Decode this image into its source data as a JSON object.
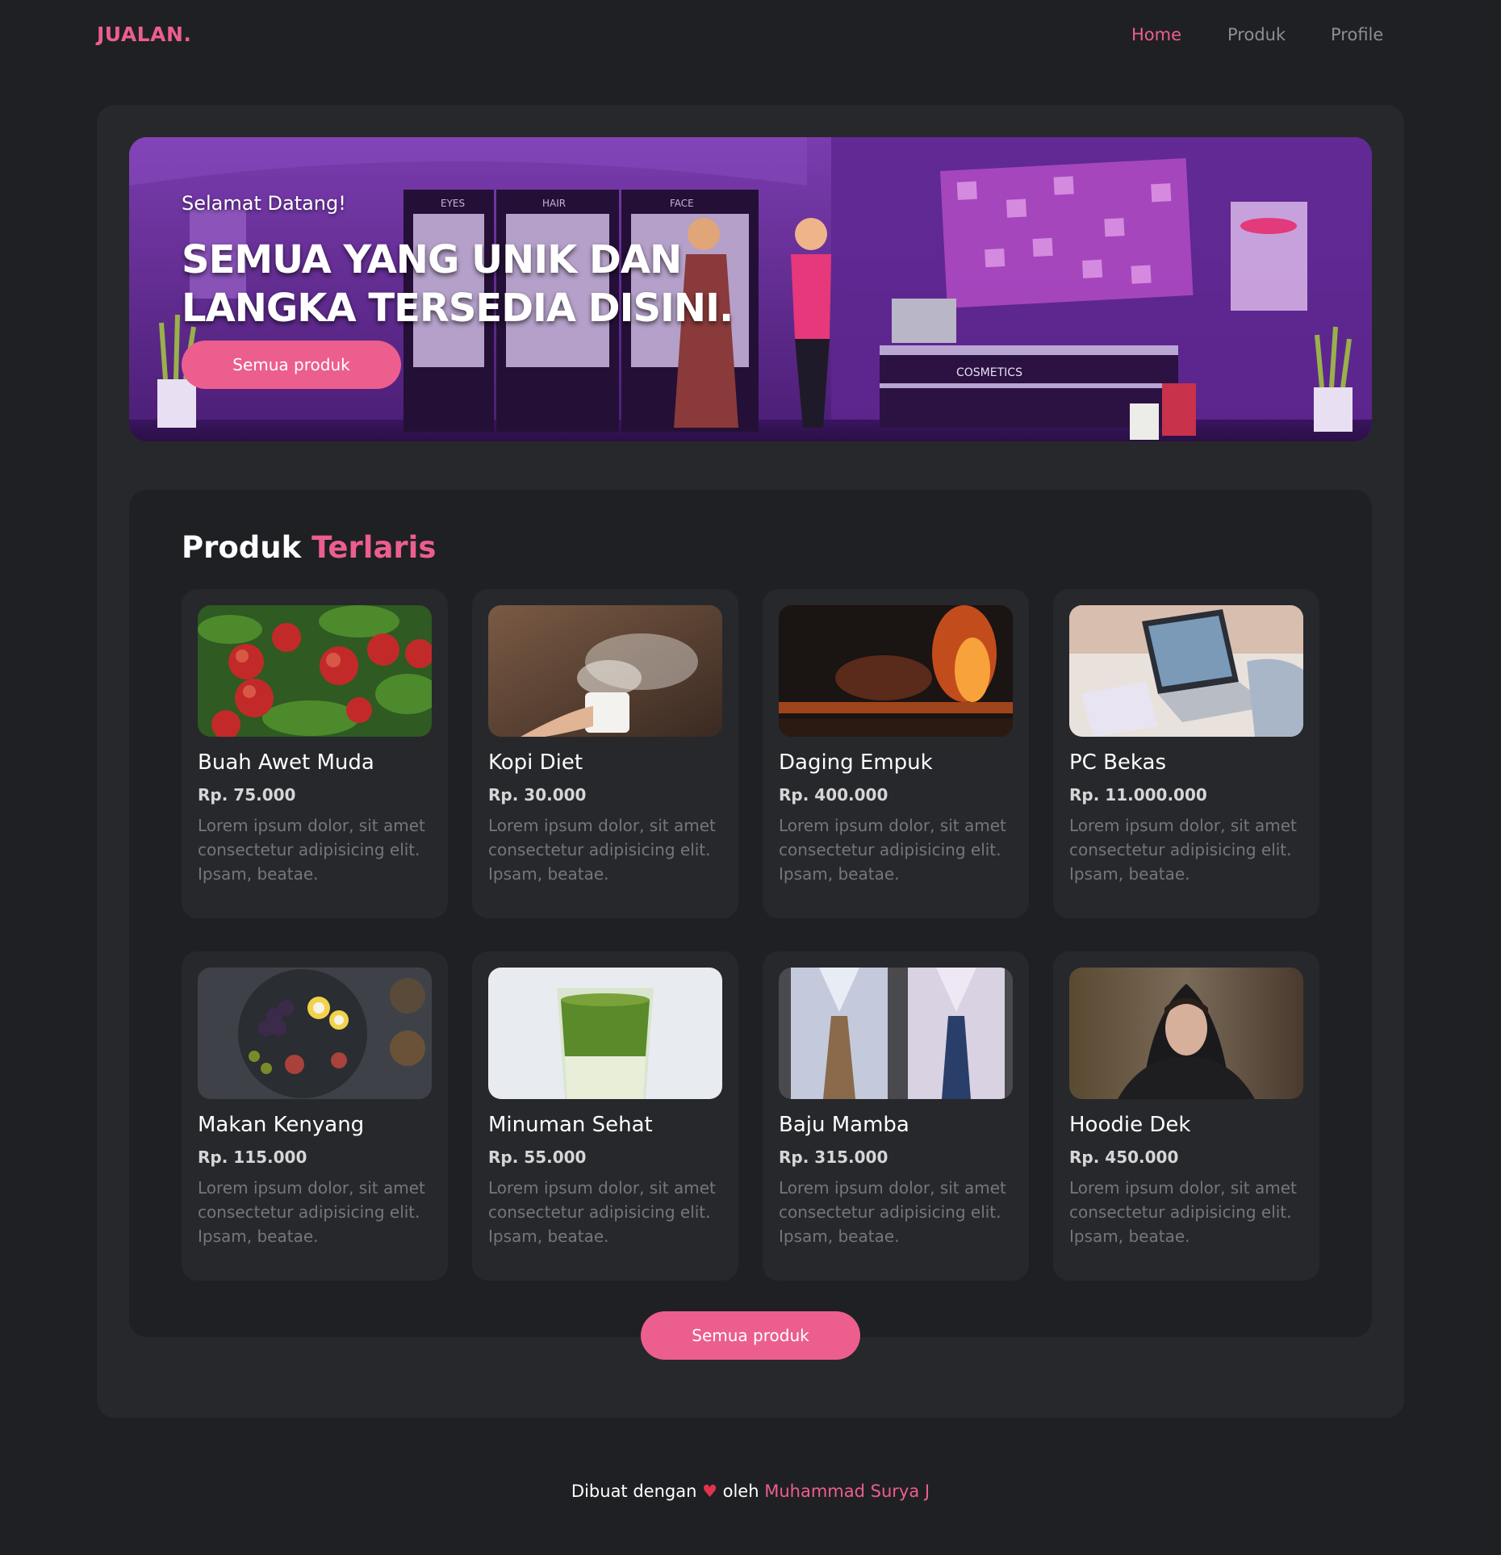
{
  "nav": {
    "logo": "JUALAN.",
    "links": [
      {
        "label": "Home",
        "active": true
      },
      {
        "label": "Produk",
        "active": false
      },
      {
        "label": "Profile",
        "active": false
      }
    ]
  },
  "hero": {
    "greeting": "Selamat Datang!",
    "title": "SEMUA YANG UNIK DAN LANGKA TERSEDIA DISINI.",
    "button_label": "Semua produk",
    "shelf_labels": [
      "EYES",
      "HAIR",
      "FACE"
    ],
    "counter_label": "COSMETICS"
  },
  "products_section": {
    "title": "Produk",
    "title_accent": "Terlaris",
    "button_label": "Semua produk",
    "items": [
      {
        "name": "Buah Awet Muda",
        "price": "Rp. 75.000",
        "desc": "Lorem ipsum dolor, sit amet consectetur adipisicing elit. Ipsam, beatae.",
        "image": "apples-photo"
      },
      {
        "name": "Kopi Diet",
        "price": "Rp. 30.000",
        "desc": "Lorem ipsum dolor, sit amet consectetur adipisicing elit. Ipsam, beatae.",
        "image": "coffee-cup-photo"
      },
      {
        "name": "Daging Empuk",
        "price": "Rp. 400.000",
        "desc": "Lorem ipsum dolor, sit amet consectetur adipisicing elit. Ipsam, beatae.",
        "image": "grilled-meat-photo"
      },
      {
        "name": "PC Bekas",
        "price": "Rp. 11.000.000",
        "desc": "Lorem ipsum dolor, sit amet consectetur adipisicing elit. Ipsam, beatae.",
        "image": "laptop-photo"
      },
      {
        "name": "Makan Kenyang",
        "price": "Rp. 115.000",
        "desc": "Lorem ipsum dolor, sit amet consectetur adipisicing elit. Ipsam, beatae.",
        "image": "food-platter-photo"
      },
      {
        "name": "Minuman Sehat",
        "price": "Rp. 55.000",
        "desc": "Lorem ipsum dolor, sit amet consectetur adipisicing elit. Ipsam, beatae.",
        "image": "matcha-drink-photo"
      },
      {
        "name": "Baju Mamba",
        "price": "Rp. 315.000",
        "desc": "Lorem ipsum dolor, sit amet consectetur adipisicing elit. Ipsam, beatae.",
        "image": "shirts-photo"
      },
      {
        "name": "Hoodie Dek",
        "price": "Rp. 450.000",
        "desc": "Lorem ipsum dolor, sit amet consectetur adipisicing elit. Ipsam, beatae.",
        "image": "hoodie-man-photo"
      }
    ]
  },
  "footer": {
    "prefix": "Dibuat dengan",
    "heart": "♥",
    "middle": "oleh",
    "author": "Muhammad Surya J"
  },
  "colors": {
    "background": "#1f2023",
    "panel": "#27282b",
    "accent": "#ec5e8e",
    "muted_text": "#75767b"
  }
}
